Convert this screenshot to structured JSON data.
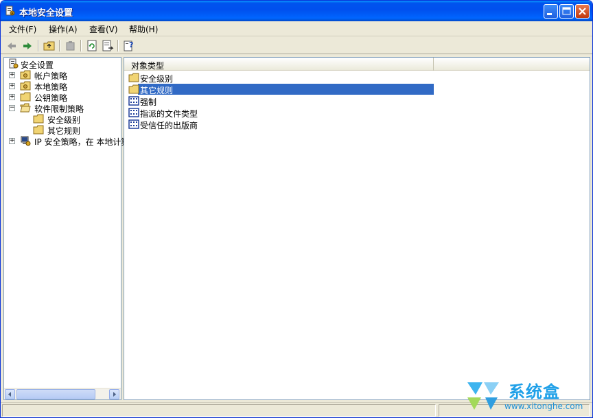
{
  "window": {
    "title": "本地安全设置"
  },
  "menu": [
    {
      "label": "文件(F)"
    },
    {
      "label": "操作(A)"
    },
    {
      "label": "查看(V)"
    },
    {
      "label": "帮助(H)"
    }
  ],
  "toolbar": [
    "back-icon",
    "forward-icon",
    "up-folder-icon",
    "delete-icon",
    "refresh-icon",
    "export-list-icon",
    "help-icon"
  ],
  "tree": {
    "root": "安全设置",
    "items": [
      {
        "label": "帐户策略",
        "expander": "+",
        "level": 1
      },
      {
        "label": "本地策略",
        "expander": "+",
        "level": 1
      },
      {
        "label": "公钥策略",
        "expander": "+",
        "level": 1
      },
      {
        "label": "软件限制策略",
        "expander": "−",
        "level": 1
      },
      {
        "label": "安全级别",
        "expander": "",
        "level": 2
      },
      {
        "label": "其它规则",
        "expander": "",
        "level": 2
      },
      {
        "label": "IP 安全策略，在 本地计算机",
        "expander": "+",
        "level": 1
      }
    ]
  },
  "list": {
    "column": "对象类型",
    "rows": [
      {
        "label": "安全级别",
        "icon": "folder-icon",
        "selected": false
      },
      {
        "label": "其它规则",
        "icon": "folder-icon",
        "selected": true
      },
      {
        "label": "强制",
        "icon": "policy-icon",
        "selected": false
      },
      {
        "label": "指派的文件类型",
        "icon": "policy-icon",
        "selected": false
      },
      {
        "label": "受信任的出版商",
        "icon": "policy-icon",
        "selected": false
      }
    ]
  },
  "watermark": {
    "name": "系统盒",
    "url": "www.xitonghe.com"
  },
  "colors": {
    "titlebar": "#0054e3",
    "selection": "#316ac5",
    "background": "#ece9d8"
  }
}
